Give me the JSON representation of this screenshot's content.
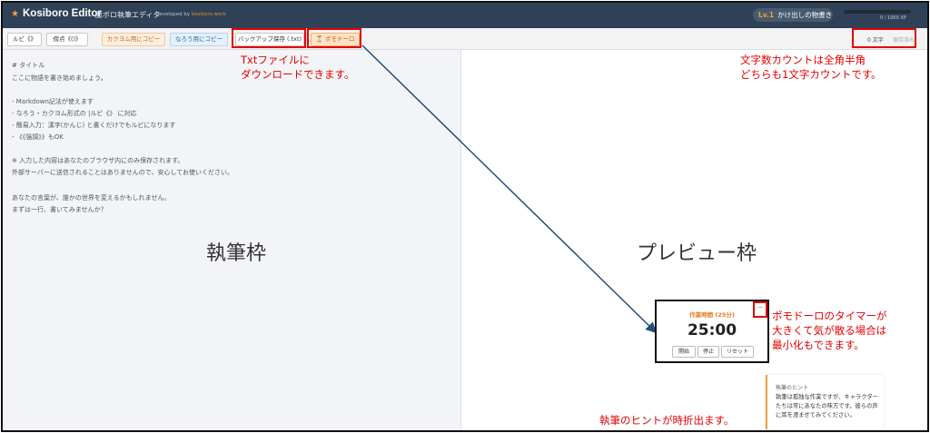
{
  "header": {
    "app_title": "Kosiboro Editor",
    "subtitle": "腰ボロ執筆エディタ",
    "developed_by": "Developed by",
    "developer": "kosiboro.work",
    "level": "Lv.1",
    "level_title": "かけ出しの物書き",
    "xp": "0 / 1000 XP",
    "xp_progress": 0
  },
  "toolbar": {
    "ruby_label": "ルビ《》",
    "emphasis_label": "傍点《()》",
    "copy_kakuyomu_label": "カクヨム用にコピー",
    "copy_narou_label": "なろう用にコピー",
    "backup_label": "バックアップ保存 (.txt)",
    "pomodoro_label": "⏳ ポモドーロ",
    "char_count": "0 文字",
    "save_status": "保存済み"
  },
  "editor": {
    "lines": [
      "# タイトル",
      "ここに物語を書き始めましょう。",
      "- Markdown記法が使えます",
      "- なろう・カクヨム形式の |ルビ《》 に対応",
      "- 簡易入力：漢字(かんじ) と書くだけでもルビになります",
      "- 《《強調》》もOK",
      "※ 入力した内容はあなたのブラウザ内にのみ保存されます。",
      "外部サーバーに送信されることはありませんので、安心してお使いください。",
      "あなたの言葉が、誰かの世界を変えるかもしれません。",
      "まずは一行、書いてみませんか？"
    ]
  },
  "annotations": {
    "writing_pane": "執筆枠",
    "preview_pane": "プレビュー枠",
    "txt_note_1": "Txtファイルに",
    "txt_note_2": "ダウンロードできます。",
    "count_note_1": "文字数カウントは全角半角",
    "count_note_2": "どちらも1文字カウントです。",
    "pomo_note_1": "ポモドーロのタイマーが",
    "pomo_note_2": "大きくて気が散る場合は",
    "pomo_note_3": "最小化もできます。",
    "hint_note": "執筆のヒントが時折出ます。"
  },
  "pomodoro": {
    "title": "作業時間 (25分)",
    "time": "25:00",
    "start_label": "開始",
    "stop_label": "停止",
    "reset_label": "リセット",
    "minimize_label": "—"
  },
  "hint": {
    "title": "執筆のヒント",
    "body": "執筆は孤独な作業ですが、キャラクターたちは常にあなたの味方です。彼らの声に耳を澄ませてみてください。"
  },
  "colors": {
    "header_bg": "#2f4156",
    "accent_orange": "#e07a1a",
    "annotation_red": "#e60000",
    "arrow": "#1f4e79"
  }
}
